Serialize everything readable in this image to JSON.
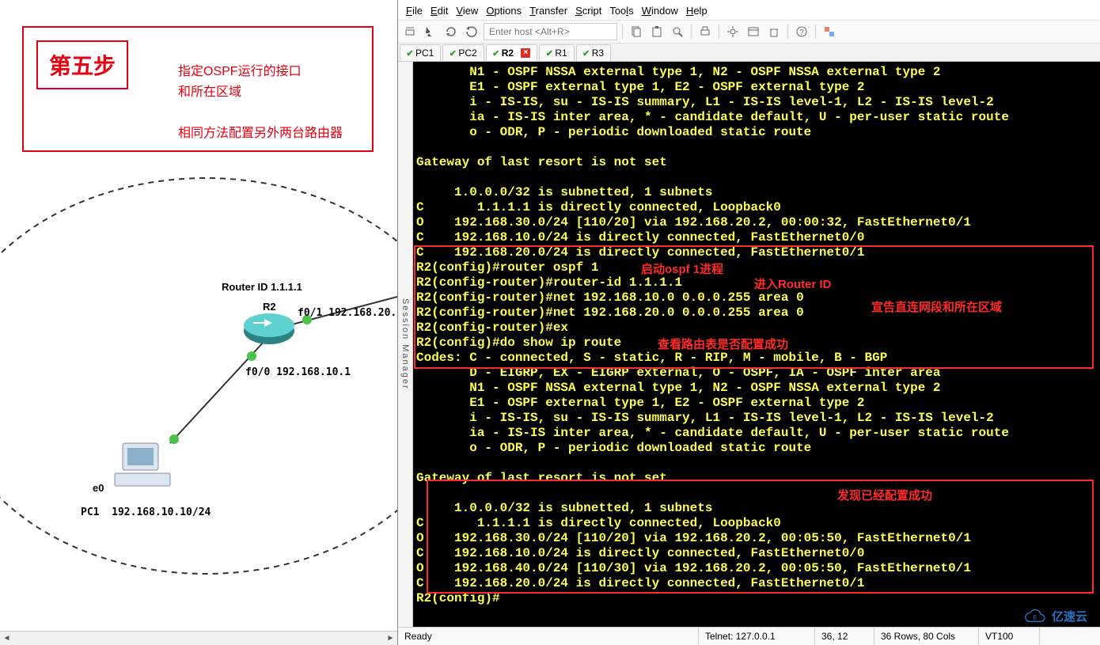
{
  "left": {
    "step_title": "第五步",
    "step_desc": "指定OSPF运行的接口\n和所在区域\n\n相同方法配置另外两台路由器",
    "router_id_label": "Router ID 1.1.1.1",
    "router_name": "R2",
    "if0_1": "f0/1 192.168.20.",
    "if0_0": "f0/0  192.168.10.1",
    "pc_if": "e0",
    "pc_name": "PC1",
    "pc_ip": "192.168.10.10/24"
  },
  "menu": {
    "file": "File",
    "edit": "Edit",
    "view": "View",
    "options": "Options",
    "transfer": "Transfer",
    "script": "Script",
    "tools": "Tools",
    "window": "Window",
    "help": "Help"
  },
  "toolbar": {
    "host_placeholder": "Enter host <Alt+R>"
  },
  "tabs": [
    {
      "label": "PC1",
      "status": "green"
    },
    {
      "label": "PC2",
      "status": "green"
    },
    {
      "label": "R2",
      "status": "green",
      "active": true,
      "closeable": true
    },
    {
      "label": "R1",
      "status": "green"
    },
    {
      "label": "R3",
      "status": "green"
    }
  ],
  "session_manager": "Session Manager",
  "terminal_lines": [
    "       N1 - OSPF NSSA external type 1, N2 - OSPF NSSA external type 2",
    "       E1 - OSPF external type 1, E2 - OSPF external type 2",
    "       i - IS-IS, su - IS-IS summary, L1 - IS-IS level-1, L2 - IS-IS level-2",
    "       ia - IS-IS inter area, * - candidate default, U - per-user static route",
    "       o - ODR, P - periodic downloaded static route",
    "",
    "Gateway of last resort is not set",
    "",
    "     1.0.0.0/32 is subnetted, 1 subnets",
    "C       1.1.1.1 is directly connected, Loopback0",
    "O    192.168.30.0/24 [110/20] via 192.168.20.2, 00:00:32, FastEthernet0/1",
    "C    192.168.10.0/24 is directly connected, FastEthernet0/0",
    "C    192.168.20.0/24 is directly connected, FastEthernet0/1",
    "R2(config)#router ospf 1",
    "R2(config-router)#router-id 1.1.1.1",
    "R2(config-router)#net 192.168.10.0 0.0.0.255 area 0",
    "R2(config-router)#net 192.168.20.0 0.0.0.255 area 0",
    "R2(config-router)#ex",
    "R2(config)#do show ip route",
    "Codes: C - connected, S - static, R - RIP, M - mobile, B - BGP",
    "       D - EIGRP, EX - EIGRP external, O - OSPF, IA - OSPF inter area",
    "       N1 - OSPF NSSA external type 1, N2 - OSPF NSSA external type 2",
    "       E1 - OSPF external type 1, E2 - OSPF external type 2",
    "       i - IS-IS, su - IS-IS summary, L1 - IS-IS level-1, L2 - IS-IS level-2",
    "       ia - IS-IS inter area, * - candidate default, U - per-user static route",
    "       o - ODR, P - periodic downloaded static route",
    "",
    "Gateway of last resort is not set",
    "",
    "     1.0.0.0/32 is subnetted, 1 subnets",
    "C       1.1.1.1 is directly connected, Loopback0",
    "O    192.168.30.0/24 [110/20] via 192.168.20.2, 00:05:50, FastEthernet0/1",
    "C    192.168.10.0/24 is directly connected, FastEthernet0/0",
    "O    192.168.40.0/24 [110/30] via 192.168.20.2, 00:05:50, FastEthernet0/1",
    "C    192.168.20.0/24 is directly connected, FastEthernet0/1",
    "R2(config)#"
  ],
  "annotations": {
    "box1": "",
    "box2": "",
    "a1": "启动ospf 1进程",
    "a2": "进入Router ID",
    "a3": "宣告直连网段和所在区域",
    "a4": "查看路由表是否配置成功",
    "a5": "发现已经配置成功"
  },
  "statusbar": {
    "ready": "Ready",
    "conn": "Telnet: 127.0.0.1",
    "cursor": "36,  12",
    "size": "36 Rows, 80 Cols",
    "emul": "VT100"
  },
  "watermark": "亿速云"
}
